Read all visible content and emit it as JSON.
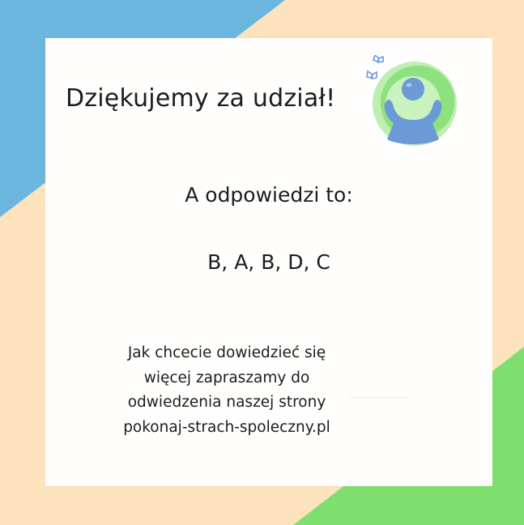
{
  "card": {
    "title": "Dziękujemy za udział!",
    "subtitle": "A odpowiedzi to:",
    "answers": "B, A, B, D, C",
    "info_lines": [
      "Jak chcecie dowiedzieć się",
      "więcej zapraszamy do",
      "odwiedzenia naszej strony",
      "pokonaj-strach-spoleczny.pl"
    ]
  },
  "colors": {
    "background": "#fde3bd",
    "blue_corner": "#6bb6df",
    "green_corner": "#7fdf6e",
    "card": "#fffefd",
    "text": "#1c1c1c",
    "emblem_green": "#8fe07f",
    "emblem_blue": "#6b9ad6"
  },
  "icons": {
    "emblem": "person-raising-arms-icon",
    "butterflies": "butterfly-icon"
  }
}
